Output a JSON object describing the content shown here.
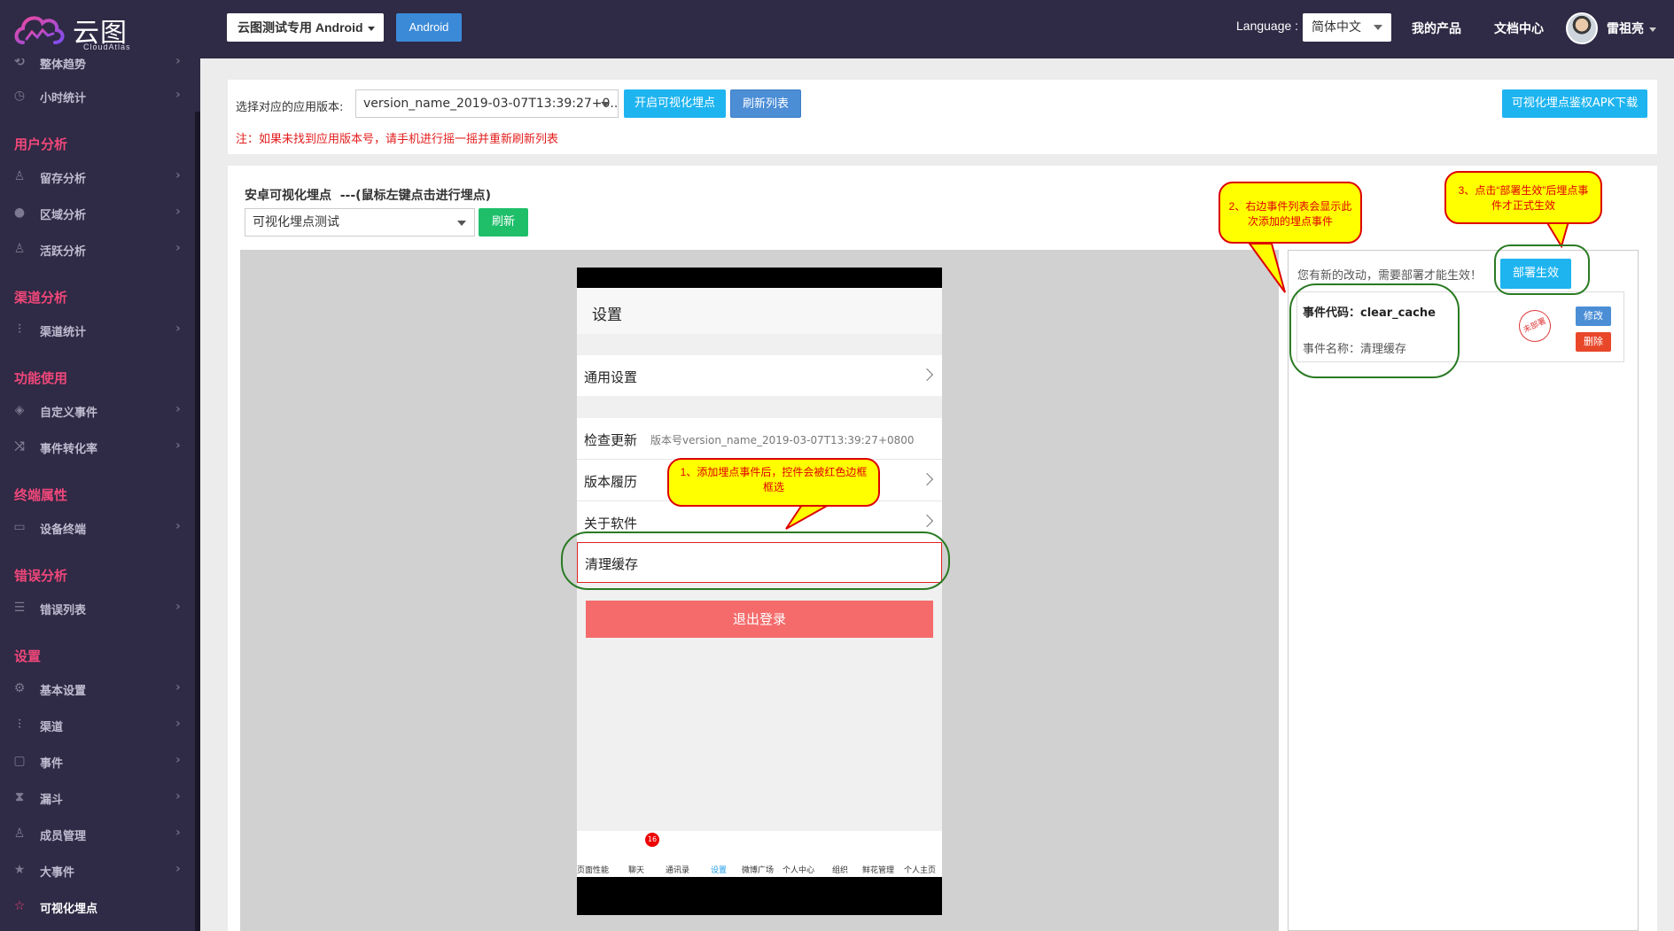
{
  "header": {
    "logo_text": "云图",
    "logo_sub": "CloudAtlas",
    "app_select": "云图测试专用 Android",
    "platform_button": "Android",
    "language_label": "Language :",
    "language_value": "简体中文",
    "links": [
      "我的产品",
      "文档中心"
    ],
    "user_name": "雷祖亮"
  },
  "sidebar": {
    "items": [
      {
        "label": "整体趋势",
        "icon": "refresh-icon"
      },
      {
        "label": "小时统计",
        "icon": "clock-icon"
      },
      {
        "heading": "用户分析"
      },
      {
        "label": "留存分析",
        "icon": "user-icon"
      },
      {
        "label": "区域分析",
        "icon": "location-icon"
      },
      {
        "label": "活跃分析",
        "icon": "user-icon"
      },
      {
        "heading": "渠道分析"
      },
      {
        "label": "渠道统计",
        "icon": "sliders-icon"
      },
      {
        "heading": "功能使用"
      },
      {
        "label": "自定义事件",
        "icon": "tag-icon"
      },
      {
        "label": "事件转化率",
        "icon": "shuffle-icon"
      },
      {
        "heading": "终端属性"
      },
      {
        "label": "设备终端",
        "icon": "monitor-icon"
      },
      {
        "heading": "错误分析"
      },
      {
        "label": "错误列表",
        "icon": "list-icon"
      },
      {
        "heading": "设置"
      },
      {
        "label": "基本设置",
        "icon": "gear-icon"
      },
      {
        "label": "渠道",
        "icon": "sliders-icon"
      },
      {
        "label": "事件",
        "icon": "clipboard-icon"
      },
      {
        "label": "漏斗",
        "icon": "hourglass-icon"
      },
      {
        "label": "成员管理",
        "icon": "user-icon"
      },
      {
        "label": "大事件",
        "icon": "star-icon"
      },
      {
        "label": "可视化埋点",
        "icon": "star-outline-icon"
      }
    ]
  },
  "version_bar": {
    "label": "选择对应的应用版本:",
    "version_value": "version_name_2019-03-07T13:39:27+0...",
    "start_button": "开启可视化埋点",
    "refresh_button": "刷新列表",
    "apk_button": "可视化埋点鉴权APK下载",
    "note": "注：如果未找到应用版本号，请手机进行摇一摇并重新刷新列表"
  },
  "visual_panel": {
    "title": "安卓可视化埋点  ---(鼠标左键点击进行埋点)",
    "test_select": "可视化埋点测试",
    "refresh_button": "刷新"
  },
  "phone": {
    "title": "设置",
    "rows": [
      {
        "label": "通用设置"
      },
      {
        "label": "检查更新",
        "detail": "版本号version_name_2019-03-07T13:39:27+0800"
      },
      {
        "label": "版本履历"
      },
      {
        "label": "关于软件"
      },
      {
        "label": "清理缓存"
      }
    ],
    "logout": "退出登录",
    "tabs": [
      "页面性能",
      "聊天",
      "通讯录",
      "设置",
      "微博广场",
      "个人中心",
      "组织",
      "鲜花管理",
      "个人主页"
    ],
    "badge": "16"
  },
  "events": {
    "notice": "您有新的改动，需要部署才能生效！",
    "deploy_button": "部署生效",
    "event_code": "事件代码：clear_cache",
    "event_name": "事件名称：清理缓存",
    "stamp": "未部署",
    "edit_button": "修改",
    "delete_button": "删除"
  },
  "annotations": {
    "note1": "1、添加埋点事件后，控件会被红色边框框选",
    "note2": "2、右边事件列表会显示此次添加的埋点事件",
    "note3": "3、点击“部署生效”后埋点事件才正式生效"
  },
  "colors": {
    "sidebar_bg": "#2f2a45",
    "section_heading": "#f0477a",
    "accent_cyan": "#1eb4f0",
    "green": "#1fbf6a",
    "danger": "#f56b6b"
  }
}
